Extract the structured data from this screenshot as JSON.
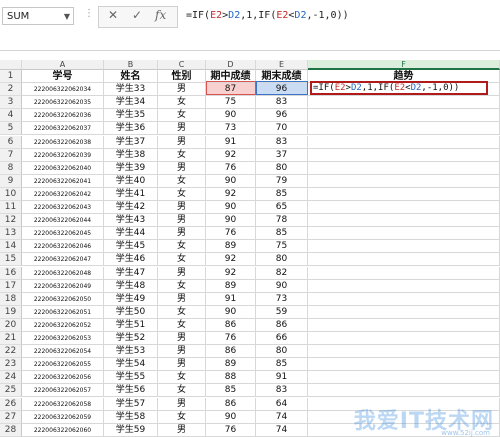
{
  "formula_bar": {
    "name_box": "SUM",
    "cancel_glyph": "✕",
    "enter_glyph": "✓",
    "fx_glyph": "fx",
    "formula_parts": [
      "=IF(",
      "E2",
      ">",
      "D2",
      ",1,IF(",
      "E2",
      "<",
      "D2",
      ",-1,0))"
    ]
  },
  "columns": [
    "A",
    "B",
    "C",
    "D",
    "E",
    "F"
  ],
  "selected_column": "F",
  "headers": [
    "学号",
    "姓名",
    "性别",
    "期中成绩",
    "期末成绩",
    "趋势"
  ],
  "rows": [
    [
      "222006322062034",
      "学生33",
      "男",
      "87",
      "96"
    ],
    [
      "222006322062035",
      "学生34",
      "女",
      "75",
      "83"
    ],
    [
      "222006322062036",
      "学生35",
      "女",
      "90",
      "96"
    ],
    [
      "222006322062037",
      "学生36",
      "男",
      "73",
      "70"
    ],
    [
      "222006322062038",
      "学生37",
      "男",
      "91",
      "83"
    ],
    [
      "222006322062039",
      "学生38",
      "女",
      "92",
      "37"
    ],
    [
      "222006322062040",
      "学生39",
      "男",
      "76",
      "80"
    ],
    [
      "222006322062041",
      "学生40",
      "女",
      "90",
      "79"
    ],
    [
      "222006322062042",
      "学生41",
      "女",
      "92",
      "85"
    ],
    [
      "222006322062043",
      "学生42",
      "男",
      "90",
      "65"
    ],
    [
      "222006322062044",
      "学生43",
      "男",
      "90",
      "78"
    ],
    [
      "222006322062045",
      "学生44",
      "男",
      "76",
      "85"
    ],
    [
      "222006322062046",
      "学生45",
      "女",
      "89",
      "75"
    ],
    [
      "222006322062047",
      "学生46",
      "女",
      "92",
      "80"
    ],
    [
      "222006322062048",
      "学生47",
      "男",
      "92",
      "82"
    ],
    [
      "222006322062049",
      "学生48",
      "女",
      "89",
      "90"
    ],
    [
      "222006322062050",
      "学生49",
      "男",
      "91",
      "73"
    ],
    [
      "222006322062051",
      "学生50",
      "女",
      "90",
      "59"
    ],
    [
      "222006322062052",
      "学生51",
      "女",
      "86",
      "86"
    ],
    [
      "222006322062053",
      "学生52",
      "男",
      "76",
      "66"
    ],
    [
      "222006322062054",
      "学生53",
      "男",
      "86",
      "80"
    ],
    [
      "222006322062055",
      "学生54",
      "男",
      "89",
      "85"
    ],
    [
      "222006322062056",
      "学生55",
      "女",
      "88",
      "91"
    ],
    [
      "222006322062057",
      "学生56",
      "女",
      "85",
      "83"
    ],
    [
      "222006322062058",
      "学生57",
      "男",
      "86",
      "64"
    ],
    [
      "222006322062059",
      "学生58",
      "女",
      "90",
      "74"
    ],
    [
      "222006322062060",
      "学生59",
      "男",
      "76",
      "74"
    ]
  ],
  "editing_cell": {
    "address": "F2",
    "content_parts": [
      "=IF(",
      "E2",
      ">",
      "D2",
      ",1,IF(",
      "E2",
      "<",
      "D2",
      ",-1,0))"
    ]
  },
  "colors": {
    "ref_red": "#c0302a",
    "ref_blue": "#1f66c4",
    "accent_green": "#217346"
  },
  "watermark": {
    "main": "我爱IT技术网",
    "sub": "www.52ij.com"
  }
}
